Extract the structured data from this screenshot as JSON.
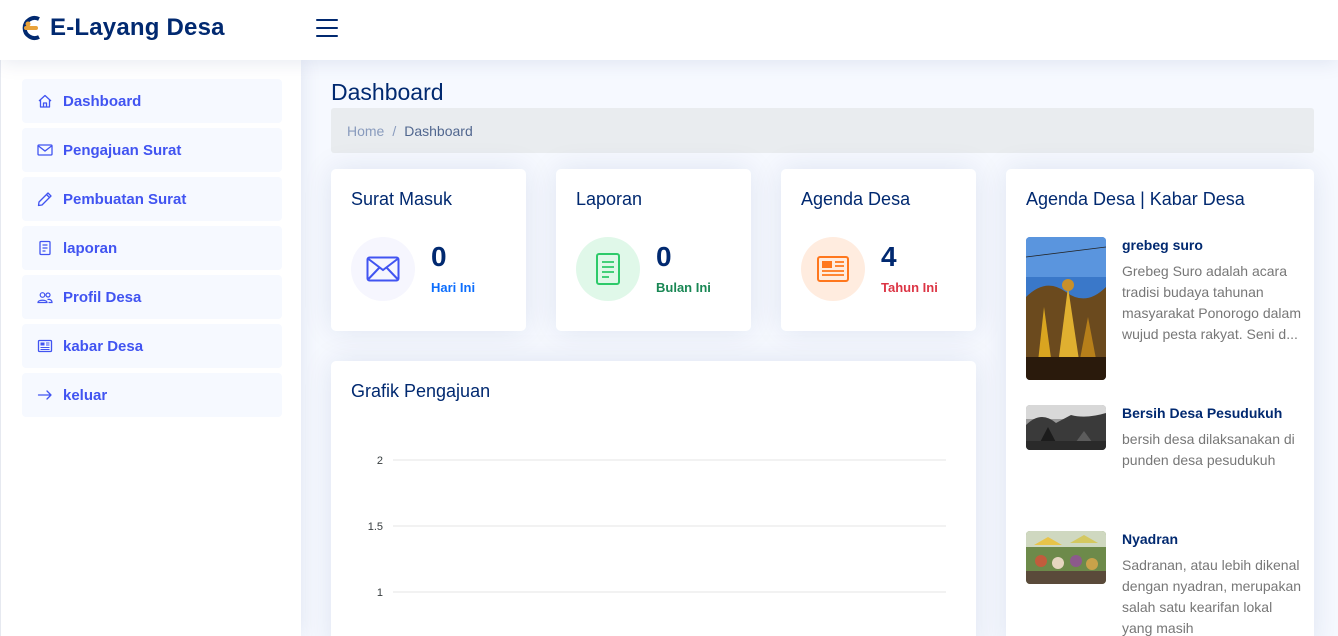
{
  "app": {
    "title": "E-Layang Desa"
  },
  "sidebar": {
    "items": [
      {
        "label": "Dashboard",
        "icon": "house-icon"
      },
      {
        "label": "Pengajuan Surat",
        "icon": "envelope-icon"
      },
      {
        "label": "Pembuatan Surat",
        "icon": "pencil-icon"
      },
      {
        "label": "laporan",
        "icon": "document-icon"
      },
      {
        "label": "Profil Desa",
        "icon": "people-icon"
      },
      {
        "label": "kabar Desa",
        "icon": "newspaper-icon"
      },
      {
        "label": "keluar",
        "icon": "arrow-right-icon"
      }
    ]
  },
  "page": {
    "title": "Dashboard",
    "breadcrumb": {
      "home": "Home",
      "separator": "/",
      "current": "Dashboard"
    }
  },
  "stats": [
    {
      "title": "Surat Masuk",
      "value": "0",
      "sub": "Hari Ini",
      "icon": "envelope-icon",
      "color": "#4154f1",
      "bg": "#f6f6fe"
    },
    {
      "title": "Laporan",
      "value": "0",
      "sub": "Bulan Ini",
      "icon": "document-icon",
      "color": "#2eca6a",
      "bg": "#e0f8e9"
    },
    {
      "title": "Agenda Desa",
      "value": "4",
      "sub": "Tahun Ini",
      "icon": "newspaper-icon",
      "color": "#ff771d",
      "bg": "#ffecdf"
    }
  ],
  "stat_sub_colors": [
    "#0d6efd",
    "#198754",
    "#dc3545"
  ],
  "chart": {
    "title": "Grafik Pengajuan"
  },
  "chart_data": {
    "type": "line",
    "title": "Grafik Pengajuan",
    "y_ticks": [
      "2",
      "1.5",
      "1"
    ],
    "y_tick_values": [
      2,
      1.5,
      1
    ],
    "grid": true
  },
  "news": {
    "title": "Agenda Desa | Kabar Desa",
    "items": [
      {
        "title": "grebeg suro",
        "desc": "Grebeg Suro adalah acara tradisi budaya tahunan masyarakat Ponorogo dalam wujud pesta rakyat. Seni d..."
      },
      {
        "title": "Bersih Desa Pesudukuh",
        "desc": "bersih desa dilaksanakan di punden desa pesudukuh"
      },
      {
        "title": "Nyadran",
        "desc": "Sadranan, atau lebih dikenal dengan nyadran, merupakan salah satu kearifan lokal yang masih"
      }
    ]
  }
}
